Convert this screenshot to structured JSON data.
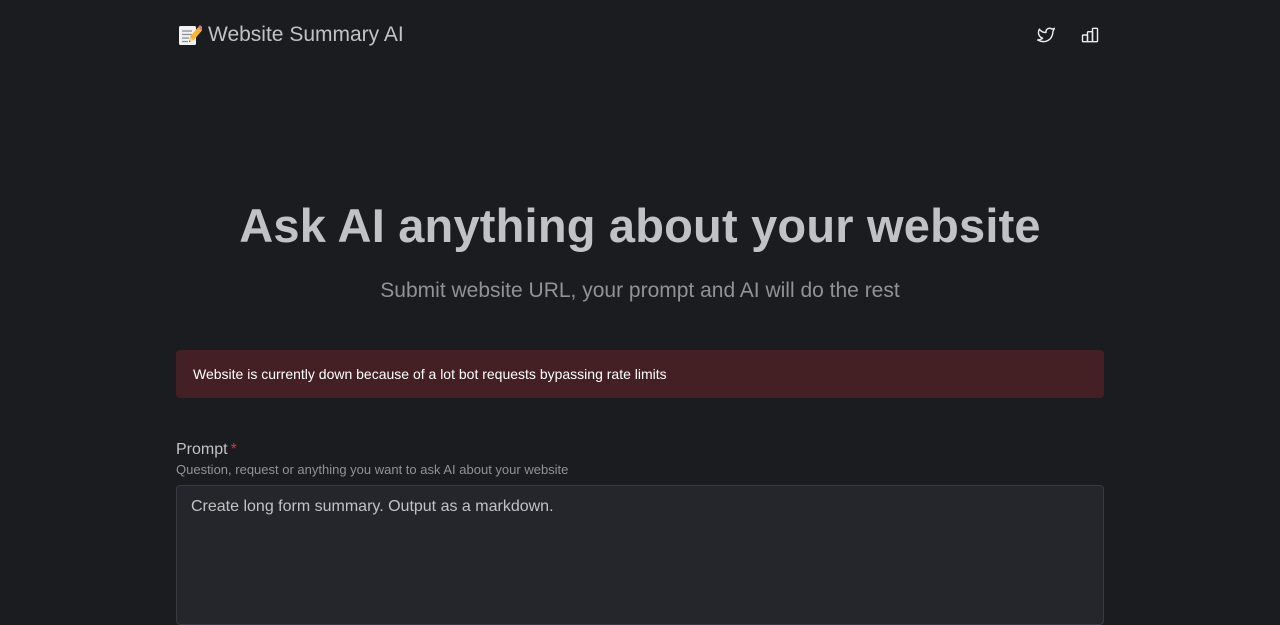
{
  "header": {
    "brand_emoji": "📝",
    "brand_title": "Website Summary AI",
    "icons": [
      "twitter-icon",
      "bar-chart-icon"
    ]
  },
  "hero": {
    "title": "Ask AI anything about your website",
    "subtitle": "Submit website URL, your prompt and AI will do the rest"
  },
  "alert": {
    "message": "Website is currently down because of a lot bot requests bypassing rate limits",
    "color": "#442024"
  },
  "prompt_field": {
    "label": "Prompt",
    "required_marker": "*",
    "description": "Question, request or anything you want to ask AI about your website",
    "value": "Create long form summary. Output as a markdown."
  },
  "colors": {
    "background": "#1b1c20",
    "text": "#c1c2c5",
    "dimmed": "#909296",
    "required": "#e03131",
    "input_bg": "#25262b",
    "input_border": "#373a40"
  }
}
